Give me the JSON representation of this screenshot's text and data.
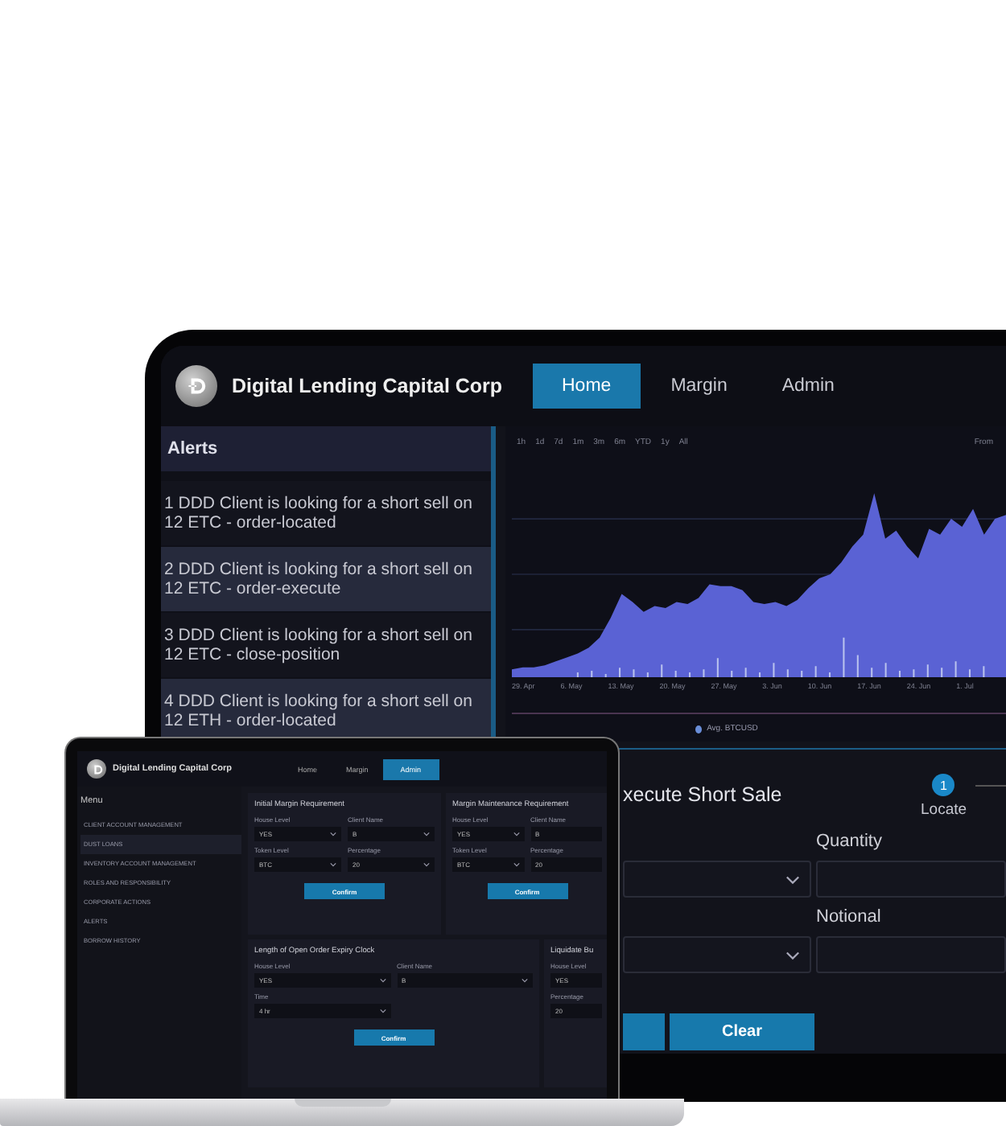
{
  "monitor": {
    "brand": {
      "title": "Digital Lending Capital Corp"
    },
    "tabs": [
      {
        "label": "Home",
        "selected": true
      },
      {
        "label": "Margin",
        "selected": false
      },
      {
        "label": "Admin",
        "selected": false
      }
    ],
    "alerts": {
      "title": "Alerts",
      "items": [
        "1 DDD Client is looking for a short sell on 12 ETC - order-located",
        "2 DDD Client is looking for a short sell on 12 ETC - order-execute",
        "3 DDD Client is looking for a short sell on 12 ETC - close-position",
        "4 DDD Client is looking for a short sell on 12 ETH - order-located"
      ]
    },
    "chart": {
      "ranges": [
        "1h",
        "1d",
        "7d",
        "1m",
        "3m",
        "6m",
        "YTD",
        "1y",
        "All"
      ],
      "from_label": "From",
      "x_labels": [
        "29. Apr",
        "6. May",
        "13. May",
        "20. May",
        "27. May",
        "3. Jun",
        "10. Jun",
        "17. Jun",
        "24. Jun",
        "1. Jul"
      ],
      "legend": "Avg. BTCUSD"
    },
    "short_sale": {
      "title": "xecute Short Sale",
      "steps": [
        {
          "number": "1",
          "label": "Locate",
          "selected": true
        }
      ],
      "fields": [
        {
          "kind": "select"
        },
        {
          "kind": "input",
          "label": "Quantity"
        },
        {
          "kind": "select"
        },
        {
          "kind": "input",
          "label": "Notional"
        }
      ],
      "buttons": [
        {
          "kind": "covered"
        },
        {
          "kind": "text",
          "label": "Clear"
        }
      ]
    }
  },
  "laptop": {
    "brand": {
      "title": "Digital Lending Capital Corp"
    },
    "tabs": [
      {
        "label": "Home",
        "selected": false
      },
      {
        "label": "Margin",
        "selected": false
      },
      {
        "label": "Admin",
        "selected": true
      }
    ],
    "menu": {
      "title": "Menu",
      "items": [
        {
          "label": "CLIENT ACCOUNT MANAGEMENT",
          "selected": false
        },
        {
          "label": "DUST LOANS",
          "selected": true
        },
        {
          "label": "INVENTORY ACCOUNT MANAGEMENT",
          "selected": false
        },
        {
          "label": "ROLES AND RESPONSIBILITY",
          "selected": false
        },
        {
          "label": "CORPORATE ACTIONS",
          "selected": false
        },
        {
          "label": "ALERTS",
          "selected": false
        },
        {
          "label": "BORROW HISTORY",
          "selected": false
        }
      ]
    },
    "panels": [
      {
        "title": "Initial Margin Requirement",
        "fields": [
          {
            "label": "House Level",
            "value": "YES",
            "kind": "select"
          },
          {
            "label": "Client Name",
            "value": "B",
            "kind": "select"
          },
          {
            "label": "Token Level",
            "value": "BTC",
            "kind": "select"
          },
          {
            "label": "Percentage",
            "value": "20",
            "kind": "select"
          }
        ],
        "button": "Confirm"
      },
      {
        "title": "Margin Maintenance Requirement",
        "fields": [
          {
            "label": "House Level",
            "value": "YES",
            "kind": "select"
          },
          {
            "label": "Client Name",
            "value": "B",
            "kind": "input"
          },
          {
            "label": "Token Level",
            "value": "BTC",
            "kind": "select"
          },
          {
            "label": "Percentage",
            "value": "20",
            "kind": "input"
          }
        ],
        "button": "Confirm"
      },
      {
        "title": "Length of Open Order Expiry Clock",
        "fields": [
          {
            "label": "House Level",
            "value": "YES",
            "kind": "select"
          },
          {
            "label": "Client Name",
            "value": "B",
            "kind": "select"
          },
          {
            "label": "Time",
            "value": "4 hr",
            "kind": "select"
          }
        ],
        "button": "Confirm"
      },
      {
        "title": "Liquidate Bu",
        "fields": [
          {
            "label": "House Level",
            "value": "YES",
            "kind": "input"
          },
          {
            "label": "Percentage",
            "value": "20",
            "kind": "input"
          }
        ]
      }
    ]
  }
}
